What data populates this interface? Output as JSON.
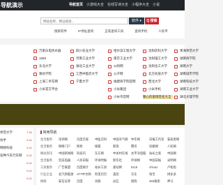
{
  "header": {
    "logo": "导航演示",
    "nav": [
      "导航首页",
      "小游戏大全",
      "在线写诗大全",
      "小程序大全",
      "小说"
    ]
  },
  "search": {
    "placeholder": "网站名称、网址链接、",
    "select": "软件 ▾",
    "button": "Q 搜索",
    "quick_links": [
      "搜索软件",
      "IP地址查询",
      "五笔查询工具",
      "查询手机",
      "人民币"
    ]
  },
  "categories": [
    [
      "",
      "万家乐电热水器",
      "四川农业大学",
      "哈尔滨工程大学",
      "沈阳药科大学",
      "青海师范大学"
    ],
    [
      "",
      "1688",
      "河南工业大学",
      "南京工业大学",
      "沈阳理工大学",
      "湖南商学院"
    ],
    [
      "",
      "东北大学",
      "湖北工业大学",
      "11利网",
      "沈阳化工大学",
      "湖南大学"
    ],
    [
      "",
      "潍坊学院",
      "江西中医药大学",
      "公子网",
      "北方民族大学",
      "湖南城市学院"
    ],
    [
      "",
      "上海二手车网",
      "宁夏大学",
      "福建商学院官网",
      "西北大学",
      "湖南科技大学"
    ],
    [
      "",
      "小米官方平台",
      "",
      "小米集团",
      "小米手机",
      "湖南工业大学"
    ],
    [
      "",
      "",
      "",
      "小米鸟官网",
      "",
      "湖北文理学院"
    ]
  ],
  "highlight_cell": "暖心的爱情签名大全",
  "sidebar": {
    "rows": [
      {
        "name": "师范大学",
        "count": "7.94"
      },
      {
        "name": "仿手",
        "count": "5.41"
      },
      {
        "name": "网络科技",
        "count": "5.41"
      },
      {
        "name": "名种汽车行车网",
        "count": "5.41"
      },
      {
        "name": "",
        "count": "5.41"
      },
      {
        "name": "",
        "count": "5.41"
      },
      {
        "name": "",
        "count": "5.41"
      }
    ]
  },
  "links_panel": {
    "title": "常用导航",
    "rows": [
      [
        "生活服务",
        "深圳网",
        "百度百家",
        "中医百科",
        "中国天气网",
        "中华网",
        "日报工作室",
        "安居客网"
      ],
      [
        "生活服务",
        "网络门户",
        "网易",
        "搜狐",
        "新浪",
        "腾讯",
        "凤凰网",
        "人民网"
      ],
      [
        "网站资讯",
        "中国新闻网",
        "科技讯",
        "东方网",
        "中关村在线",
        "太平洋电脑",
        "站长之家",
        "中国网"
      ],
      [
        "生活服务",
        "宏成电器",
        "人民日报",
        "环球时报",
        "新华社",
        "环球网",
        "中国日报",
        "光明网"
      ],
      [
        "工具服务",
        "广告联盟",
        "百度统计",
        "站长工具",
        "爱站网",
        "5118",
        "chinaz",
        "卢松松"
      ],
      [
        "行业企业",
        "北汽新能源",
        "ATT中文网",
        "阿里巴巴",
        "美团",
        "京东",
        "淘宝",
        "拼多多"
      ],
      [
        "网络",
        "安信证券",
        "百度",
        "谷歌",
        "必应",
        "搜狗",
        "360搜索",
        "神马"
      ]
    ]
  },
  "colors": {
    "topbar": "#22262b",
    "accent": "#c6262d",
    "banner": "#4a4410",
    "highlight": "#f3e4a6"
  }
}
